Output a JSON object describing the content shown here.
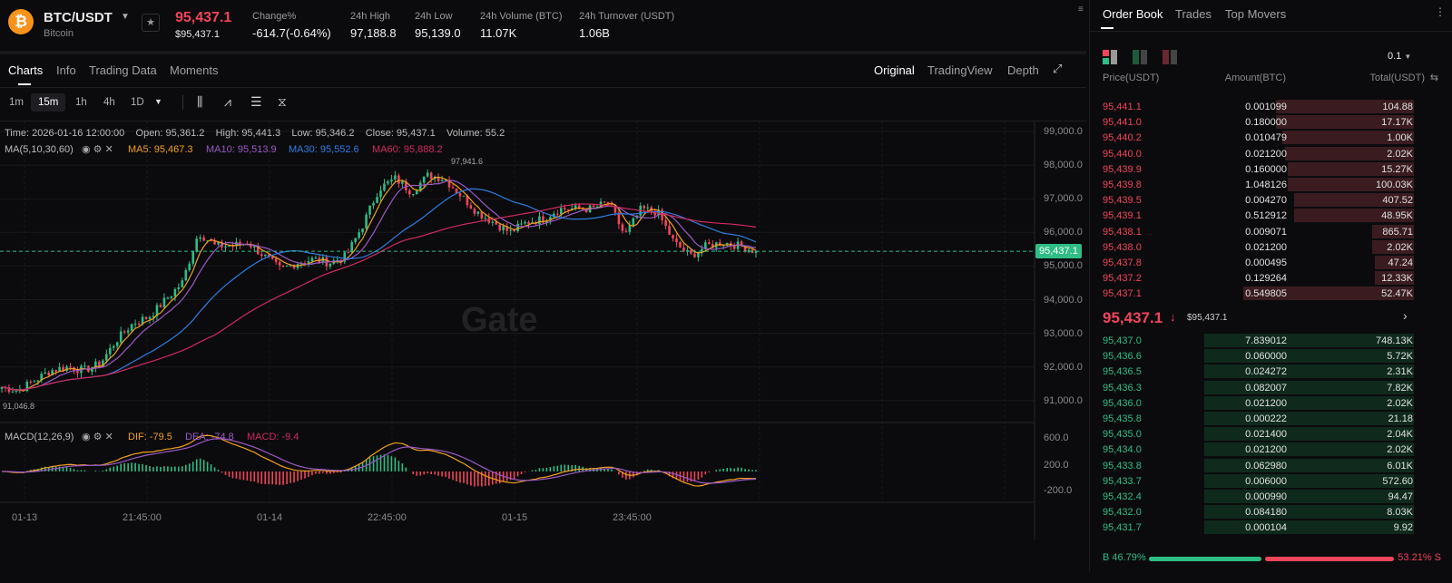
{
  "header": {
    "pair": "BTC/USDT",
    "name": "Bitcoin",
    "price": "95,437.1",
    "price_usd": "$95,437.1",
    "stats": [
      {
        "label": "Change%",
        "value": "-614.7(-0.64%)"
      },
      {
        "label": "24h High",
        "value": "97,188.8"
      },
      {
        "label": "24h Low",
        "value": "95,139.0"
      },
      {
        "label": "24h Volume (BTC)",
        "value": "11.07K"
      },
      {
        "label": "24h Turnover (USDT)",
        "value": "1.06B"
      }
    ]
  },
  "tabs": [
    "Charts",
    "Info",
    "Trading Data",
    "Moments"
  ],
  "views": [
    "Original",
    "TradingView",
    "Depth"
  ],
  "timeframes": [
    "1m",
    "15m",
    "1h",
    "4h",
    "1D"
  ],
  "ohlc": "Time: 2026-01-16 12:00:00    Open: 95,361.2    High: 95,441.3    Low: 95,346.2    Close: 95,437.1    Volume: 55.2",
  "ma": {
    "label": "MA(5,10,30,60)",
    "ma5": "MA5: 95,467.3",
    "ma10": "MA10: 95,513.9",
    "ma30": "MA30: 95,552.6",
    "ma60": "MA60: 95,888.2"
  },
  "macd": {
    "label": "MACD(12,26,9)",
    "dif": "DIF: -79.5",
    "dea": "DEA: -74.8",
    "macd": "MACD: -9.4",
    "ticks": [
      "600.0",
      "200.0",
      "-200.0"
    ]
  },
  "price_ticks": [
    "99,000.0",
    "98,000.0",
    "97,000.0",
    "96,000.0",
    "95,000.0",
    "94,000.0",
    "93,000.0",
    "92,000.0",
    "91,000.0"
  ],
  "time_ticks": [
    "01-13",
    "21:45:00",
    "01-14",
    "22:45:00",
    "01-15",
    "23:45:00"
  ],
  "high_mark": "97,941.6",
  "low_mark": "91,046.8",
  "last_price_tag": "95,437.1",
  "watermark": "Gate",
  "colors": {
    "up": "#2ebd85",
    "down": "#f0455a",
    "ma5": "#f0a020",
    "ma10": "#9b59c6",
    "ma30": "#2f7de1",
    "ma60": "#d02a5e"
  },
  "chart_data": {
    "type": "candlestick",
    "close_keypoints": [
      91400,
      91300,
      91600,
      91900,
      92000,
      91900,
      92100,
      92800,
      93300,
      93500,
      94000,
      94500,
      96000,
      95600,
      95600,
      95700,
      95300,
      94900,
      95100,
      95200,
      95100,
      95300,
      96200,
      97300,
      97600,
      97200,
      97700,
      97600,
      97100,
      96600,
      96300,
      96000,
      96300,
      96400,
      96700,
      96700,
      96700,
      96900,
      95900,
      96700,
      96600,
      95700,
      95300,
      95600,
      95700,
      95600,
      95437
    ],
    "ylim": [
      90500,
      99000
    ]
  },
  "orderbook": {
    "tabs": [
      "Order Book",
      "Trades",
      "Top Movers"
    ],
    "precision": "0.1",
    "cols": [
      "Price(USDT)",
      "Amount(BTC)",
      "Total(USDT)"
    ],
    "asks": [
      [
        "95,441.1",
        "0.001099",
        "104.88",
        0.46
      ],
      [
        "95,441.0",
        "0.180000",
        "17.17K",
        0.46
      ],
      [
        "95,440.2",
        "0.010479",
        "1.00K",
        0.44
      ],
      [
        "95,440.0",
        "0.021200",
        "2.02K",
        0.43
      ],
      [
        "95,439.9",
        "0.160000",
        "15.27K",
        0.42
      ],
      [
        "95,439.8",
        "1.048126",
        "100.03K",
        0.42
      ],
      [
        "95,439.5",
        "0.004270",
        "407.52",
        0.4
      ],
      [
        "95,439.1",
        "0.512912",
        "48.95K",
        0.4
      ],
      [
        "95,438.1",
        "0.009071",
        "865.71",
        0.14
      ],
      [
        "95,438.0",
        "0.021200",
        "2.02K",
        0.14
      ],
      [
        "95,437.8",
        "0.000495",
        "47.24",
        0.13
      ],
      [
        "95,437.2",
        "0.129264",
        "12.33K",
        0.13
      ],
      [
        "95,437.1",
        "0.549805",
        "52.47K",
        0.57
      ]
    ],
    "mid": "95,437.1",
    "mid_usd": "$95,437.1",
    "bids": [
      [
        "95,437.0",
        "7.839012",
        "748.13K",
        0.7
      ],
      [
        "95,436.6",
        "0.060000",
        "5.72K",
        0.7
      ],
      [
        "95,436.5",
        "0.024272",
        "2.31K",
        0.7
      ],
      [
        "95,436.3",
        "0.082007",
        "7.82K",
        0.7
      ],
      [
        "95,436.0",
        "0.021200",
        "2.02K",
        0.7
      ],
      [
        "95,435.8",
        "0.000222",
        "21.18",
        0.7
      ],
      [
        "95,435.0",
        "0.021400",
        "2.04K",
        0.7
      ],
      [
        "95,434.0",
        "0.021200",
        "2.02K",
        0.7
      ],
      [
        "95,433.8",
        "0.062980",
        "6.01K",
        0.7
      ],
      [
        "95,433.7",
        "0.006000",
        "572.60",
        0.7
      ],
      [
        "95,432.4",
        "0.000990",
        "94.47",
        0.7
      ],
      [
        "95,432.0",
        "0.084180",
        "8.03K",
        0.7
      ],
      [
        "95,431.7",
        "0.000104",
        "9.92",
        0.7
      ]
    ],
    "buy_pct": "B 46.79%",
    "sell_pct": "53.21% S",
    "buy_ratio": 0.4679
  }
}
